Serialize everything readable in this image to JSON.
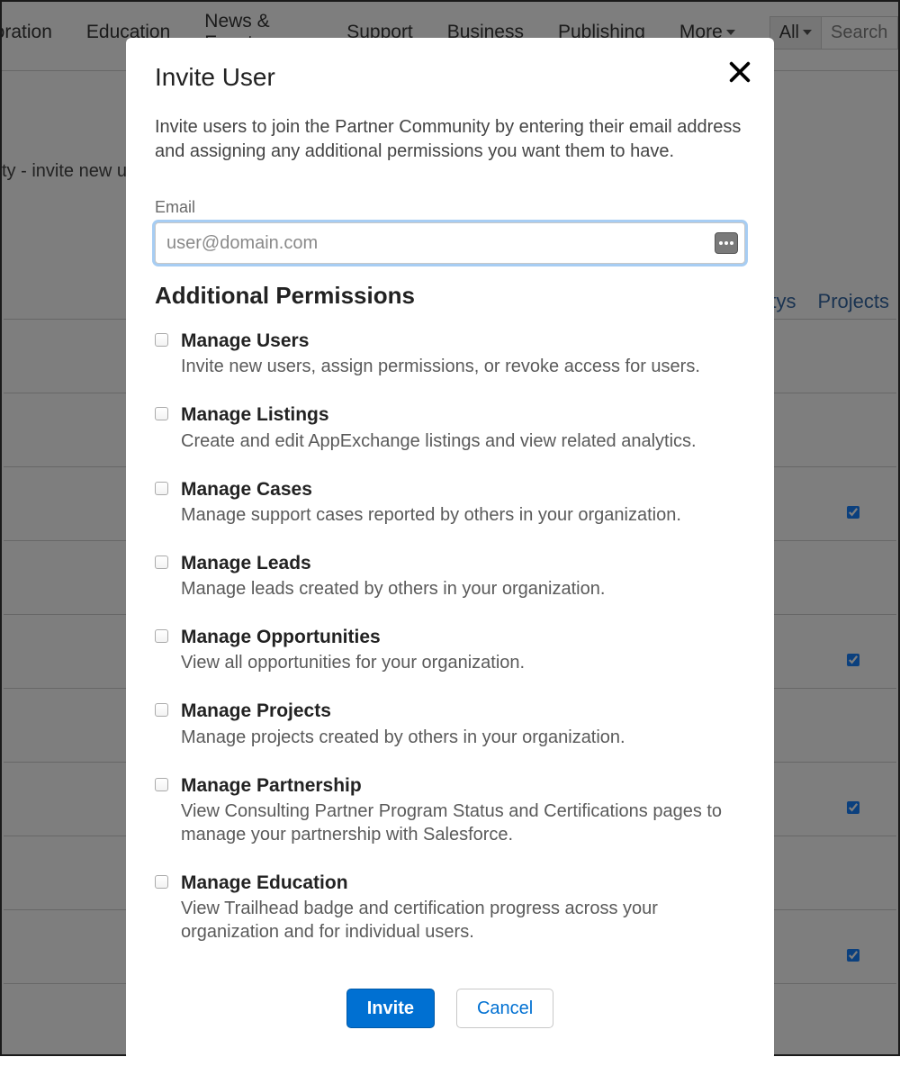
{
  "nav": {
    "items": [
      "boration",
      "Education",
      "News & Events",
      "Support",
      "Business",
      "Publishing"
    ],
    "more": "More",
    "all": "All",
    "search_placeholder": "Search..."
  },
  "background": {
    "title_frag": "ty - invite new u",
    "tabs": [
      "ptys",
      "Projects"
    ],
    "checks": [
      false,
      true,
      false,
      true,
      false,
      true,
      false,
      true,
      false
    ]
  },
  "modal": {
    "title": "Invite User",
    "description": "Invite users to join the Partner Community by entering their email address and assigning any additional permissions you want them to have.",
    "email_label": "Email",
    "email_placeholder": "user@domain.com",
    "section_heading": "Additional Permissions",
    "invite_label": "Invite",
    "cancel_label": "Cancel"
  },
  "permissions": [
    {
      "title": "Manage Users",
      "desc": "Invite new users, assign permissions, or revoke access for users."
    },
    {
      "title": "Manage Listings",
      "desc": "Create and edit AppExchange listings and view related analytics."
    },
    {
      "title": "Manage Cases",
      "desc": "Manage support cases reported by others in your organization."
    },
    {
      "title": "Manage Leads",
      "desc": "Manage leads created by others in your organization."
    },
    {
      "title": "Manage Opportunities",
      "desc": "View all opportunities for your organization."
    },
    {
      "title": "Manage Projects",
      "desc": "Manage projects created by others in your organization."
    },
    {
      "title": "Manage Partnership",
      "desc": "View Consulting Partner Program Status and Certifications pages to manage your partnership with Salesforce."
    },
    {
      "title": "Manage Education",
      "desc": "View Trailhead badge and certification progress across your organization and for individual users."
    }
  ]
}
